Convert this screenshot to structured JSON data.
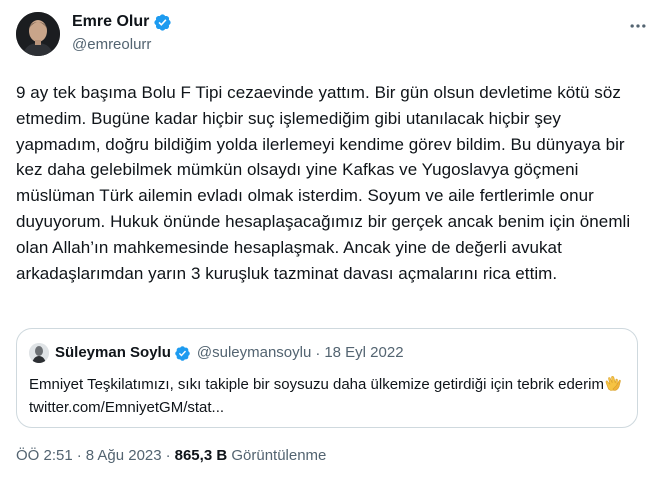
{
  "author": {
    "name": "Emre Olur",
    "handle": "@emreolurr",
    "verified": true
  },
  "tweet": {
    "text": "9 ay tek başıma Bolu F Tipi cezaevinde yattım. Bir gün olsun devletime kötü söz etmedim. Bugüne kadar hiçbir suç işlemediğim gibi utanılacak hiçbir şey yapmadım, doğru bildiğim yolda ilerlemeyi kendime görev bildim. Bu dünyaya bir kez daha gelebilmek mümkün olsaydı yine Kafkas ve Yugoslavya göçmeni müslüman Türk ailemin evladı olmak isterdim. Soyum ve aile fertlerimle onur duyuyorum. Hukuk önünde hesaplaşacağımız bir gerçek ancak benim için önemli olan Allah’ın mahkemesinde hesaplaşmak. Ancak yine de değerli avukat arkadaşlarımdan yarın 3 kuruşluk tazminat davası açmalarını rica ettim."
  },
  "quote": {
    "name": "Süleyman Soylu",
    "handle": "@suleymansoylu",
    "separator": "·",
    "date": "18 Eyl 2022",
    "text_before_emoji": "Emniyet Teşkilatımızı, sıkı takiple bir soysuzu daha ülkemize getirdiği için tebrik ederim",
    "emoji_icon": "clapping-hands-icon",
    "link": "twitter.com/EmniyetGM/stat..."
  },
  "meta": {
    "time": "ÖÖ 2:51",
    "separator": "·",
    "date": "8 Ağu 2023",
    "views_count": "865,3 B",
    "views_label": "Görüntülenme"
  },
  "colors": {
    "verified_blue": "#1d9bf0",
    "secondary_text": "#536471",
    "border": "#cfd9de",
    "primary_text": "#0f1419"
  }
}
